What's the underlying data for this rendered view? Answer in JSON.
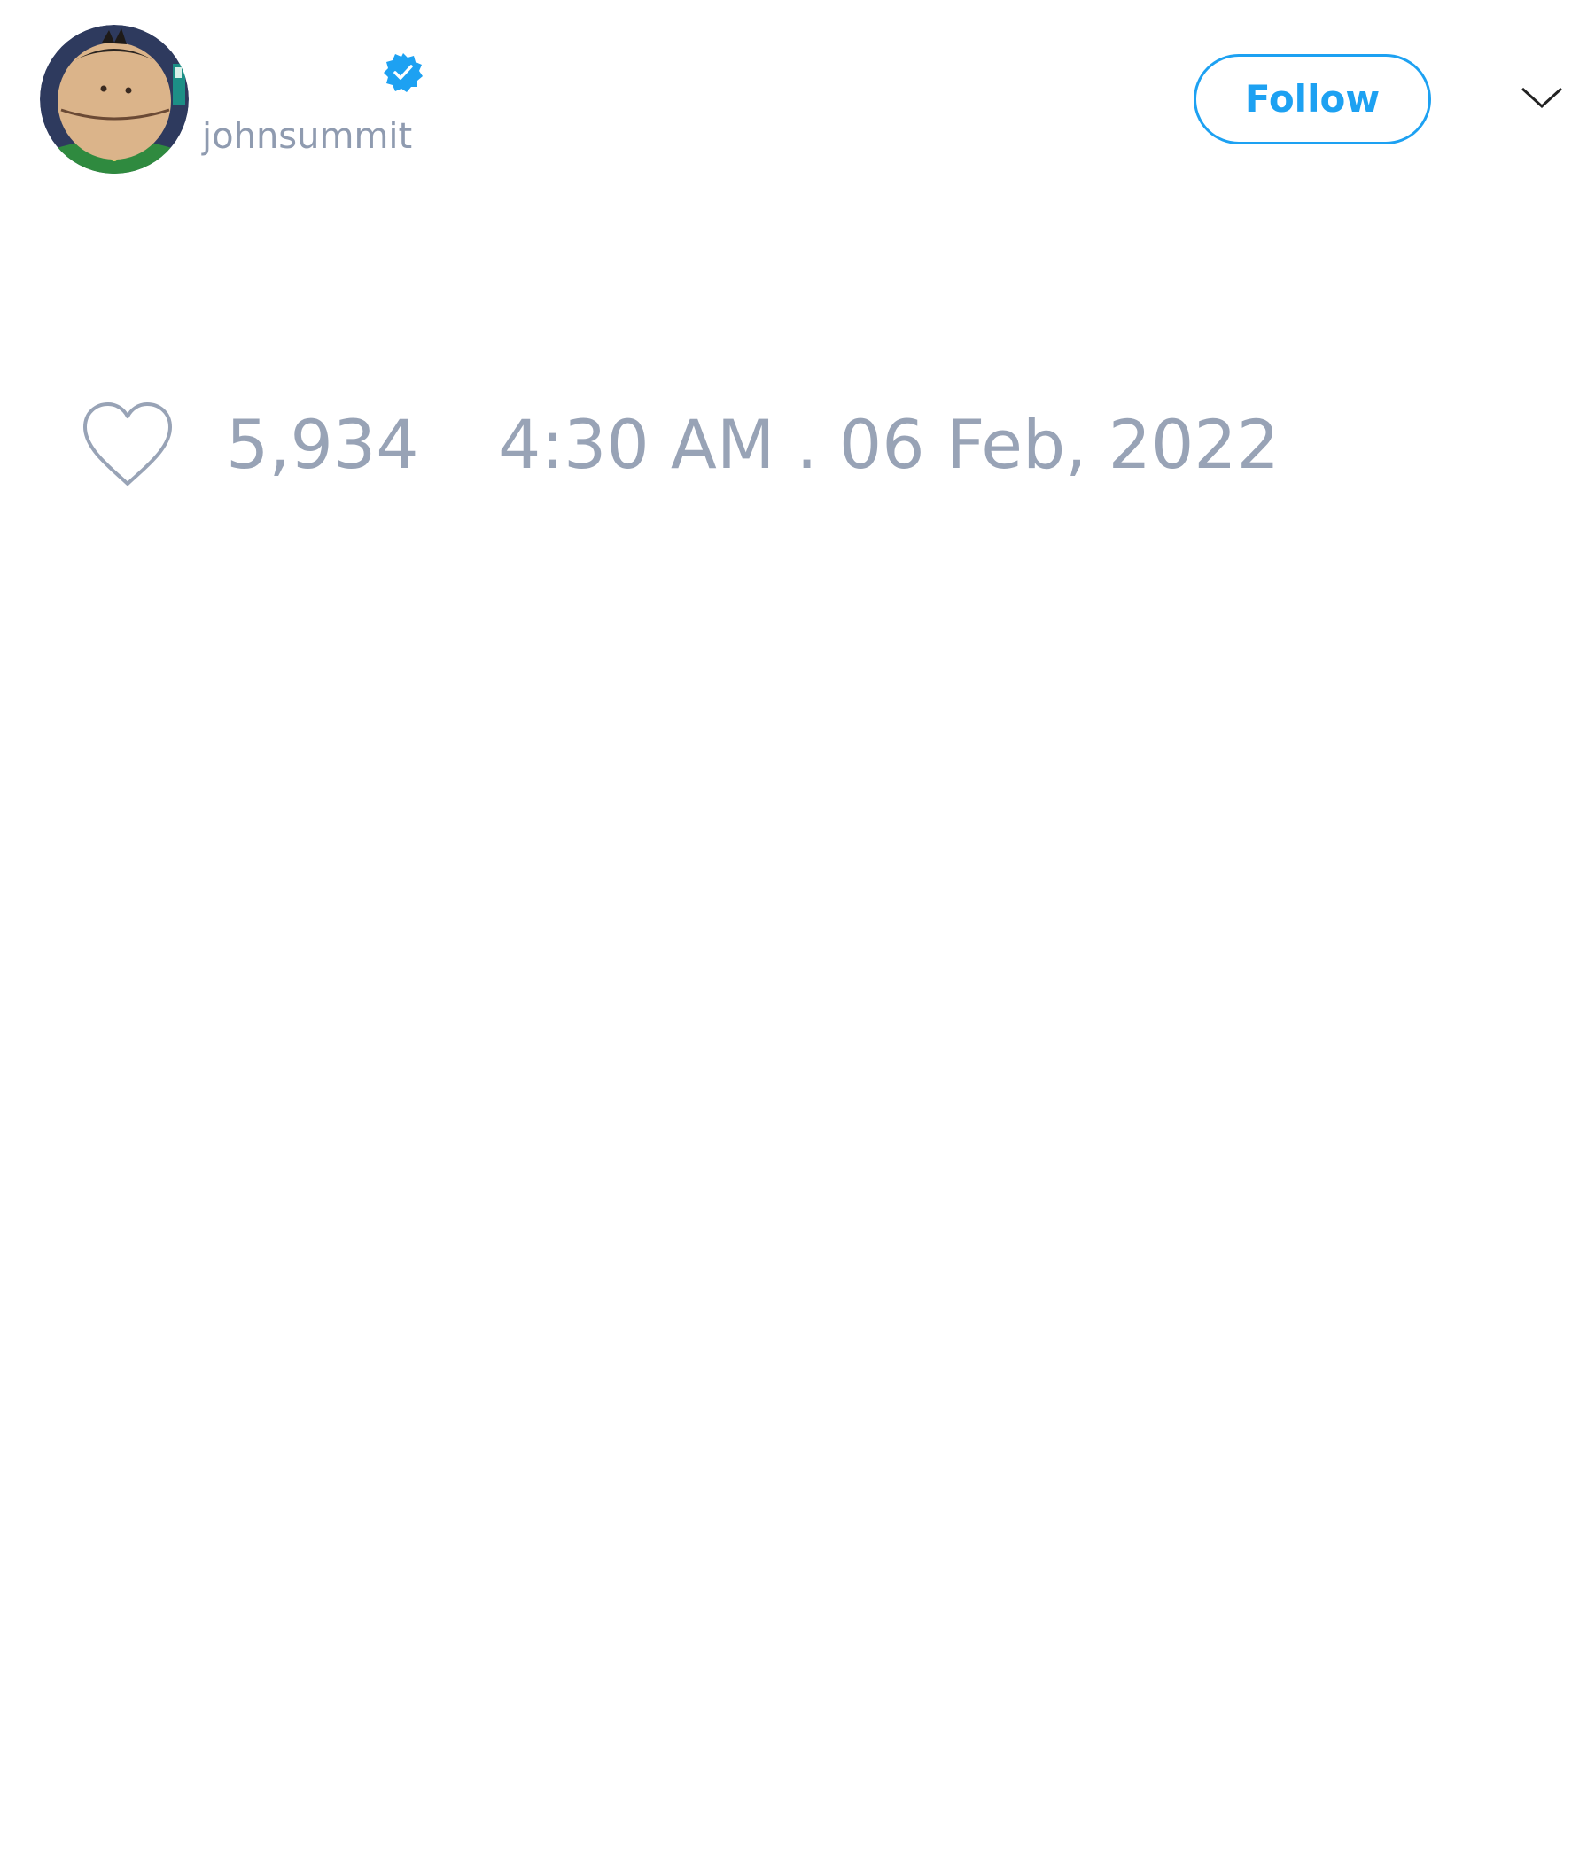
{
  "tweet": {
    "author": {
      "username": "johnsummit",
      "verified": true,
      "avatar_icon": "cartoon-avatar-icon"
    },
    "follow_label": "Follow",
    "likes": "5,934",
    "timestamp": "4:30 AM . 06 Feb, 2022"
  },
  "colors": {
    "accent": "#1da1f2",
    "meta_text": "#98a3b6",
    "username_text": "#8f9bb0"
  }
}
